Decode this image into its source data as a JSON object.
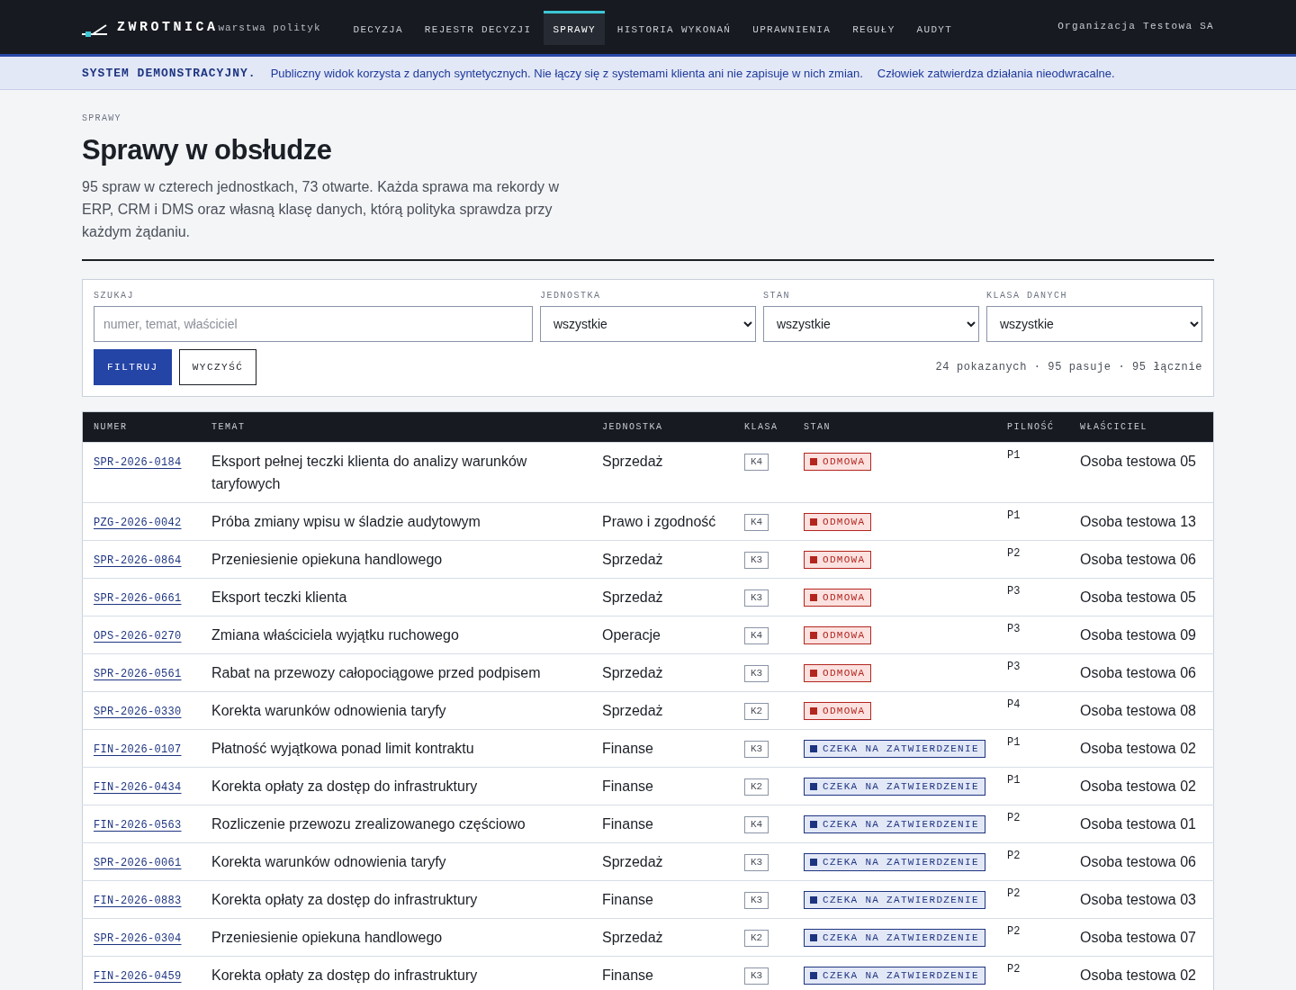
{
  "brand": {
    "name": "ZWROTNICA",
    "tagline": "warstwa polityk"
  },
  "nav": [
    {
      "label": "DECYZJA",
      "selected": false
    },
    {
      "label": "REJESTR DECYZJI",
      "selected": false
    },
    {
      "label": "SPRAWY",
      "selected": true
    },
    {
      "label": "HISTORIA WYKONAŃ",
      "selected": false
    },
    {
      "label": "UPRAWNIENIA",
      "selected": false
    },
    {
      "label": "REGUŁY",
      "selected": false
    },
    {
      "label": "AUDYT",
      "selected": false
    }
  ],
  "organization": "Organizacja Testowa SA",
  "banner": {
    "title": "SYSTEM DEMONSTRACYJNY.",
    "texts": [
      "Publiczny widok korzysta z danych syntetycznych. Nie łączy się z systemami klienta ani nie zapisuje w nich zmian.",
      "Człowiek zatwierdza działania nieodwracalne."
    ]
  },
  "breadcrumb": "SPRAWY",
  "title": "Sprawy w obsłudze",
  "description": "95 spraw w czterech jednostkach, 73 otwarte. Każda sprawa ma rekordy w ERP, CRM i DMS oraz własną klasę danych, którą polityka sprawdza przy każdym żądaniu.",
  "filters": {
    "search": {
      "label": "SZUKAJ",
      "placeholder": "numer, temat, właściciel"
    },
    "selects": [
      {
        "label": "JEDNOSTKA",
        "value": "wszystkie"
      },
      {
        "label": "STAN",
        "value": "wszystkie"
      },
      {
        "label": "KLASA DANYCH",
        "value": "wszystkie"
      }
    ],
    "buttons": [
      {
        "label": "FILTRUJ",
        "kind": "primary"
      },
      {
        "label": "WYCZYŚĆ",
        "kind": "secondary"
      }
    ],
    "summary": "24 pokazanych · 95 pasuje · 95 łącznie"
  },
  "table": {
    "columns": [
      "NUMER",
      "TEMAT",
      "JEDNOSTKA",
      "KLASA",
      "STAN",
      "PILNOŚĆ",
      "WŁAŚCICIEL"
    ],
    "rows": [
      {
        "number": "SPR-2026-0184",
        "subject": "Eksport pełnej teczki klienta do analizy warunków taryfowych",
        "unit": "Sprzedaż",
        "class": "K4",
        "status": {
          "label": "ODMOWA",
          "kind": "rejected"
        },
        "priority": "P1",
        "owner": "Osoba testowa 05"
      },
      {
        "number": "PZG-2026-0042",
        "subject": "Próba zmiany wpisu w śladzie audytowym",
        "unit": "Prawo i zgodność",
        "class": "K4",
        "status": {
          "label": "ODMOWA",
          "kind": "rejected"
        },
        "priority": "P1",
        "owner": "Osoba testowa 13"
      },
      {
        "number": "SPR-2026-0864",
        "subject": "Przeniesienie opiekuna handlowego",
        "unit": "Sprzedaż",
        "class": "K3",
        "status": {
          "label": "ODMOWA",
          "kind": "rejected"
        },
        "priority": "P2",
        "owner": "Osoba testowa 06"
      },
      {
        "number": "SPR-2026-0661",
        "subject": "Eksport teczki klienta",
        "unit": "Sprzedaż",
        "class": "K3",
        "status": {
          "label": "ODMOWA",
          "kind": "rejected"
        },
        "priority": "P3",
        "owner": "Osoba testowa 05"
      },
      {
        "number": "OPS-2026-0270",
        "subject": "Zmiana właściciela wyjątku ruchowego",
        "unit": "Operacje",
        "class": "K4",
        "status": {
          "label": "ODMOWA",
          "kind": "rejected"
        },
        "priority": "P3",
        "owner": "Osoba testowa 09"
      },
      {
        "number": "SPR-2026-0561",
        "subject": "Rabat na przewozy całopociągowe przed podpisem",
        "unit": "Sprzedaż",
        "class": "K3",
        "status": {
          "label": "ODMOWA",
          "kind": "rejected"
        },
        "priority": "P3",
        "owner": "Osoba testowa 06"
      },
      {
        "number": "SPR-2026-0330",
        "subject": "Korekta warunków odnowienia taryfy",
        "unit": "Sprzedaż",
        "class": "K2",
        "status": {
          "label": "ODMOWA",
          "kind": "rejected"
        },
        "priority": "P4",
        "owner": "Osoba testowa 08"
      },
      {
        "number": "FIN-2026-0107",
        "subject": "Płatność wyjątkowa ponad limit kontraktu",
        "unit": "Finanse",
        "class": "K3",
        "status": {
          "label": "CZEKA NA ZATWIERDZENIE",
          "kind": "pending"
        },
        "priority": "P1",
        "owner": "Osoba testowa 02"
      },
      {
        "number": "FIN-2026-0434",
        "subject": "Korekta opłaty za dostęp do infrastruktury",
        "unit": "Finanse",
        "class": "K2",
        "status": {
          "label": "CZEKA NA ZATWIERDZENIE",
          "kind": "pending"
        },
        "priority": "P1",
        "owner": "Osoba testowa 02"
      },
      {
        "number": "FIN-2026-0563",
        "subject": "Rozliczenie przewozu zrealizowanego częściowo",
        "unit": "Finanse",
        "class": "K4",
        "status": {
          "label": "CZEKA NA ZATWIERDZENIE",
          "kind": "pending"
        },
        "priority": "P2",
        "owner": "Osoba testowa 01"
      },
      {
        "number": "SPR-2026-0061",
        "subject": "Korekta warunków odnowienia taryfy",
        "unit": "Sprzedaż",
        "class": "K3",
        "status": {
          "label": "CZEKA NA ZATWIERDZENIE",
          "kind": "pending"
        },
        "priority": "P2",
        "owner": "Osoba testowa 06"
      },
      {
        "number": "FIN-2026-0883",
        "subject": "Korekta opłaty za dostęp do infrastruktury",
        "unit": "Finanse",
        "class": "K3",
        "status": {
          "label": "CZEKA NA ZATWIERDZENIE",
          "kind": "pending"
        },
        "priority": "P2",
        "owner": "Osoba testowa 03"
      },
      {
        "number": "SPR-2026-0304",
        "subject": "Przeniesienie opiekuna handlowego",
        "unit": "Sprzedaż",
        "class": "K2",
        "status": {
          "label": "CZEKA NA ZATWIERDZENIE",
          "kind": "pending"
        },
        "priority": "P2",
        "owner": "Osoba testowa 07"
      },
      {
        "number": "FIN-2026-0459",
        "subject": "Korekta opłaty za dostęp do infrastruktury",
        "unit": "Finanse",
        "class": "K3",
        "status": {
          "label": "CZEKA NA ZATWIERDZENIE",
          "kind": "pending"
        },
        "priority": "P2",
        "owner": "Osoba testowa 02"
      }
    ]
  }
}
